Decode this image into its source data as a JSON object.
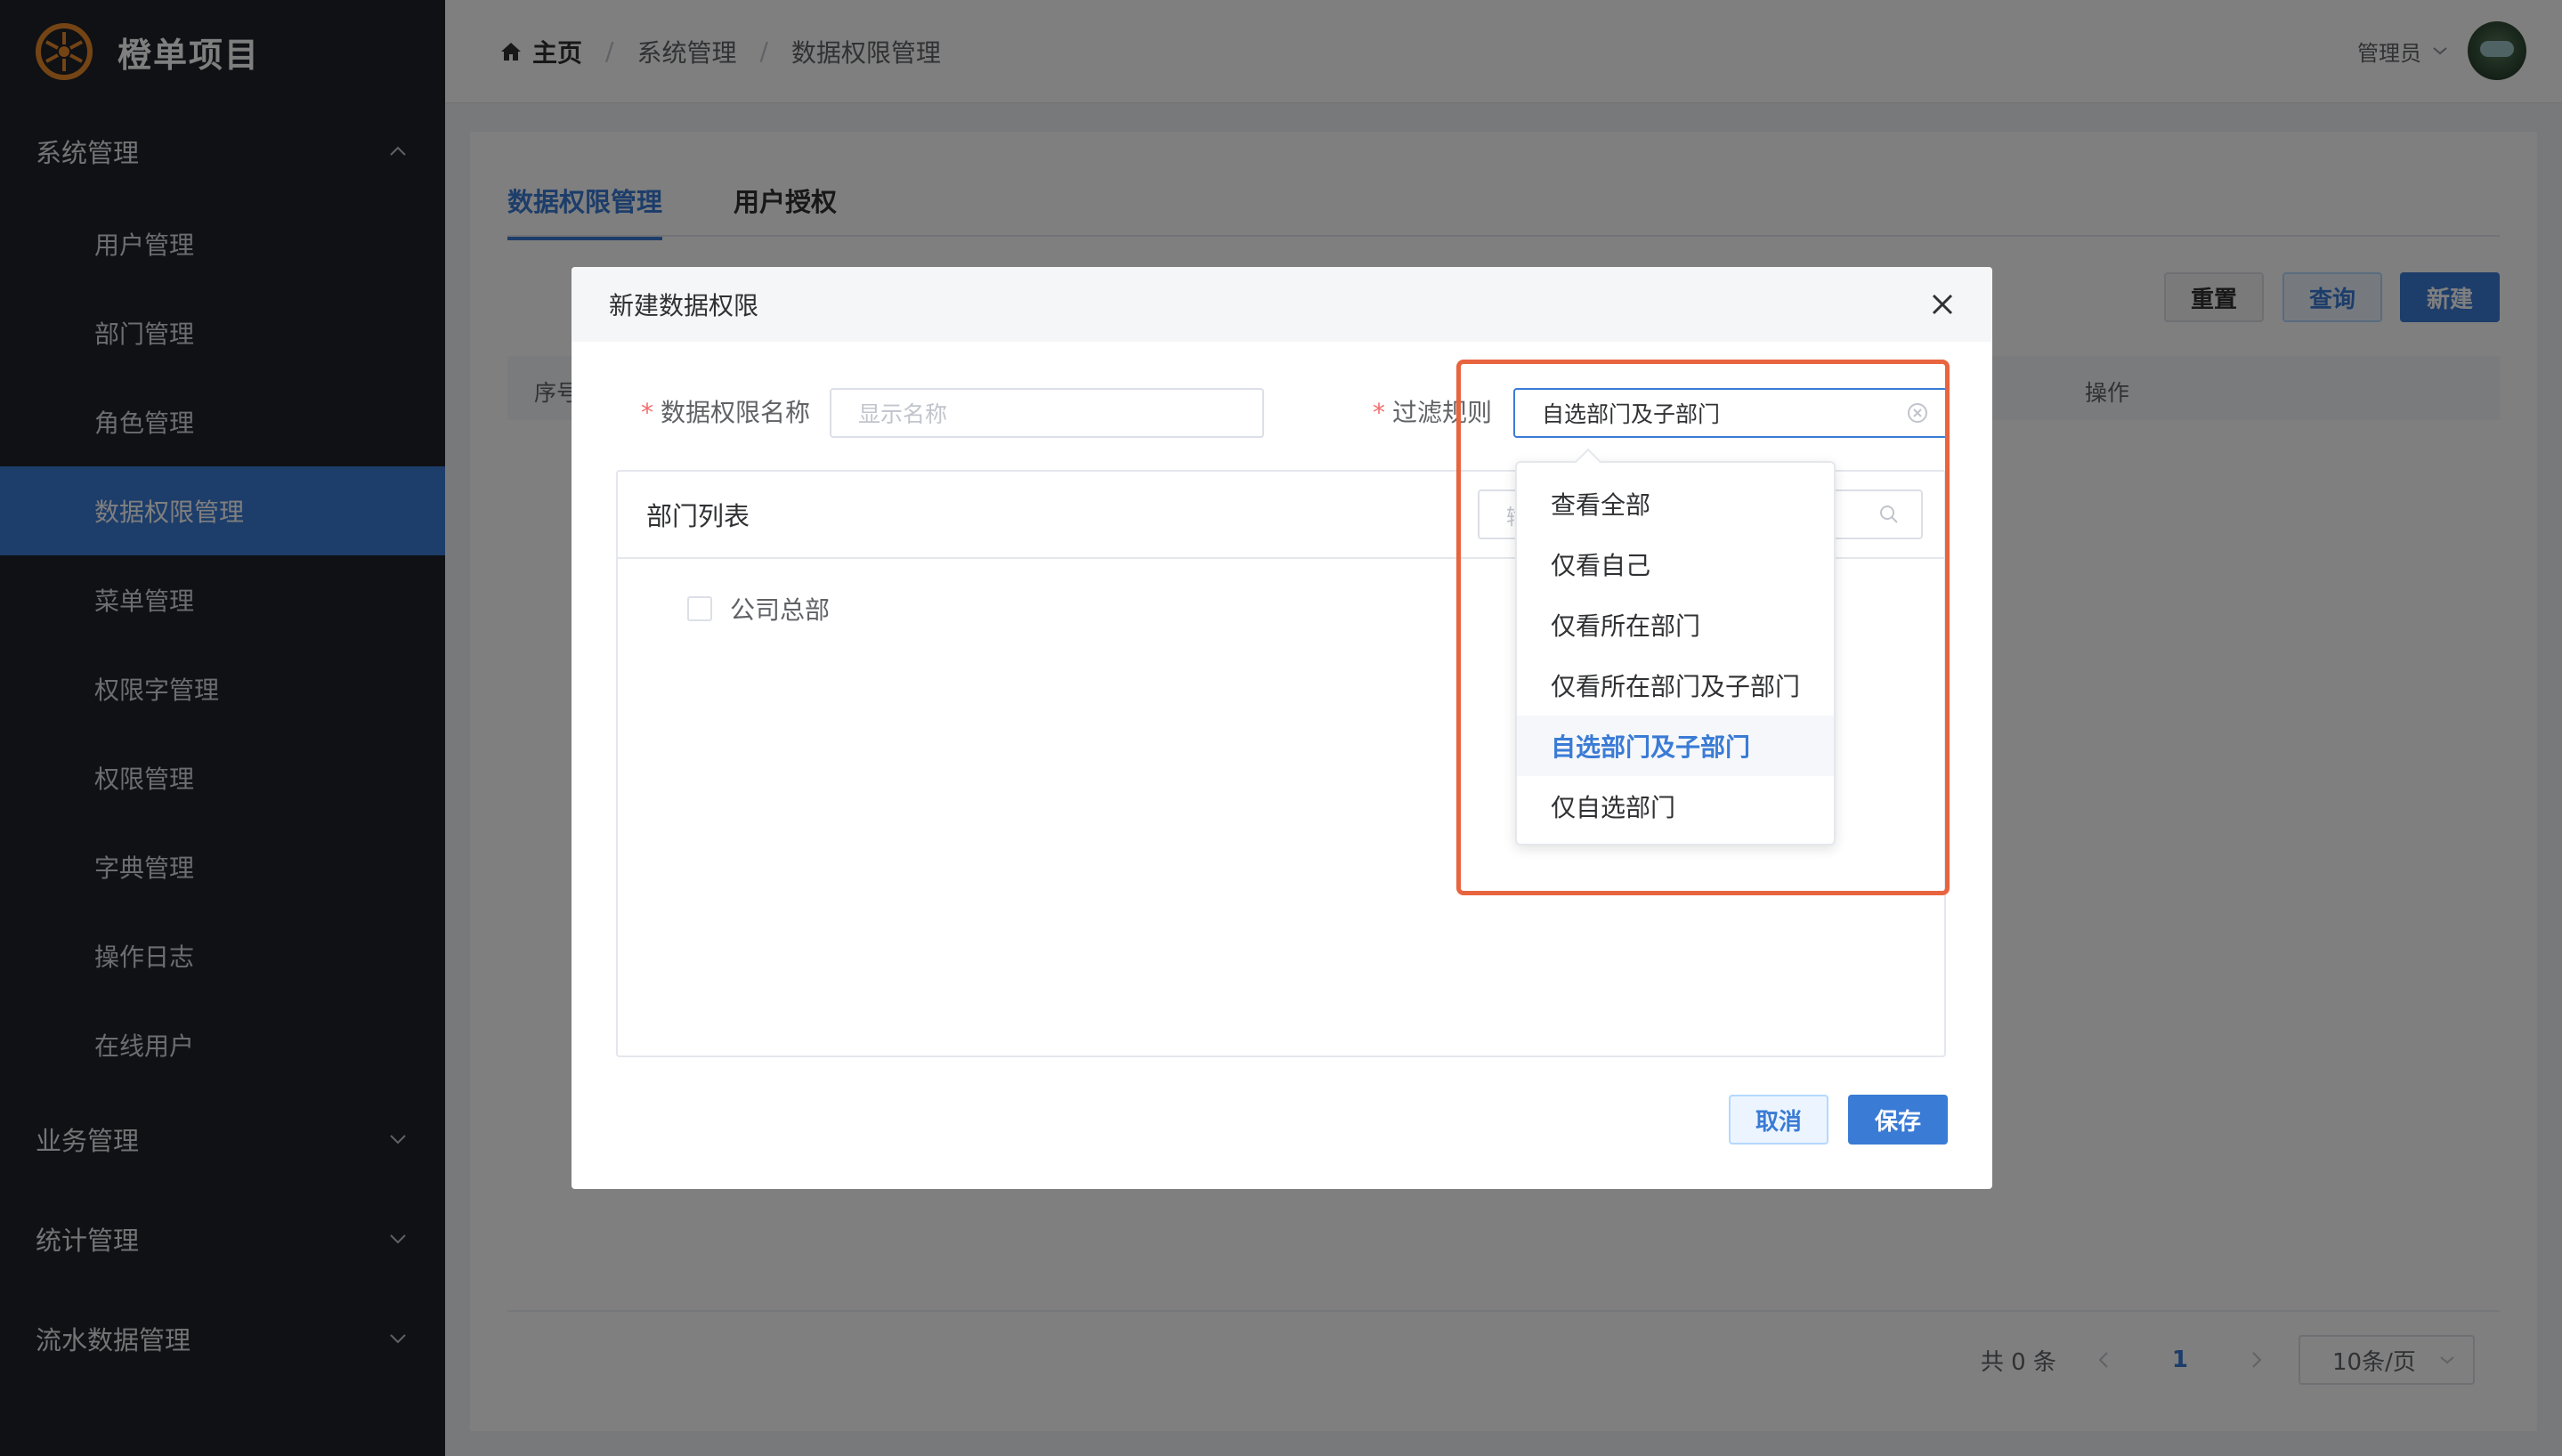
{
  "brand": {
    "title": "橙单项目",
    "logo_icon": "orange-slice-icon",
    "accent": "#e8892b"
  },
  "sidebar": {
    "groups": [
      {
        "label": "系统管理",
        "expanded": true,
        "items": [
          {
            "label": "用户管理"
          },
          {
            "label": "部门管理"
          },
          {
            "label": "角色管理"
          },
          {
            "label": "数据权限管理",
            "active": true
          },
          {
            "label": "菜单管理"
          },
          {
            "label": "权限字管理"
          },
          {
            "label": "权限管理"
          },
          {
            "label": "字典管理"
          },
          {
            "label": "操作日志"
          },
          {
            "label": "在线用户"
          }
        ]
      },
      {
        "label": "业务管理",
        "expanded": false
      },
      {
        "label": "统计管理",
        "expanded": false
      },
      {
        "label": "流水数据管理",
        "expanded": false
      }
    ]
  },
  "header": {
    "breadcrumb": [
      "主页",
      "系统管理",
      "数据权限管理"
    ],
    "user": {
      "name": "管理员"
    }
  },
  "page": {
    "tabs": [
      {
        "label": "数据权限管理",
        "active": true
      },
      {
        "label": "用户授权",
        "active": false
      }
    ],
    "buttons": {
      "reset": "重置",
      "query": "查询",
      "create": "新建"
    },
    "table_headers": {
      "index": "序号",
      "actions": "操作"
    },
    "pager": {
      "total": "共 0 条",
      "current_page": "1",
      "page_size": "10条/页"
    }
  },
  "dialog": {
    "title": "新建数据权限",
    "name_label": "数据权限名称",
    "name_placeholder": "显示名称",
    "rule_label": "过滤规则",
    "rule_value": "自选部门及子部门",
    "panel_title": "部门列表",
    "panel_search_placeholder": "输",
    "tree": [
      {
        "label": "公司总部",
        "checked": false
      }
    ],
    "cancel": "取消",
    "save": "保存"
  },
  "dropdown": {
    "options": [
      {
        "label": "查看全部"
      },
      {
        "label": "仅看自己"
      },
      {
        "label": "仅看所在部门"
      },
      {
        "label": "仅看所在部门及子部门"
      },
      {
        "label": "自选部门及子部门",
        "selected": true
      },
      {
        "label": "仅自选部门"
      }
    ]
  },
  "colors": {
    "primary": "#3a7bd5",
    "highlight_border": "#e8643f",
    "sidebar_bg": "#1f2329"
  }
}
